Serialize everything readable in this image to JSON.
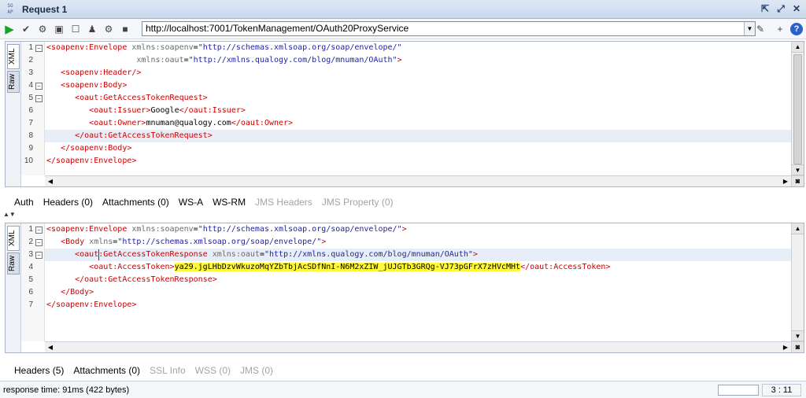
{
  "window": {
    "title": "Request 1",
    "soap_top": "SO",
    "soap_bottom": "AP"
  },
  "toolbar": {
    "url": "http://localhost:7001/TokenManagement/OAuth20ProxyService",
    "help": "?"
  },
  "request": {
    "tabs": {
      "xml": "XML",
      "raw": "Raw"
    },
    "lines": [
      {
        "n": "1",
        "fold": "−",
        "indent": "",
        "parts": [
          [
            "tag",
            "<soapenv:Envelope"
          ],
          [
            "attr",
            " xmlns:soapenv"
          ],
          [
            "text",
            "="
          ],
          [
            "val",
            "\"http://schemas.xmlsoap.org/soap/envelope/\""
          ]
        ]
      },
      {
        "n": "2",
        "fold": "",
        "indent": "                   ",
        "parts": [
          [
            "attr",
            "xmlns:oaut"
          ],
          [
            "text",
            "="
          ],
          [
            "val",
            "\"http://xmlns.qualogy.com/blog/mnuman/OAuth\""
          ],
          [
            "tag",
            ">"
          ]
        ]
      },
      {
        "n": "3",
        "fold": "",
        "indent": "   ",
        "parts": [
          [
            "tag",
            "<soapenv:Header/>"
          ]
        ]
      },
      {
        "n": "4",
        "fold": "−",
        "indent": "   ",
        "parts": [
          [
            "tag",
            "<soapenv:Body>"
          ]
        ]
      },
      {
        "n": "5",
        "fold": "−",
        "indent": "      ",
        "parts": [
          [
            "tag",
            "<oaut:GetAccessTokenRequest>"
          ]
        ]
      },
      {
        "n": "6",
        "fold": "",
        "indent": "         ",
        "parts": [
          [
            "tag",
            "<oaut:Issuer>"
          ],
          [
            "text",
            "Google"
          ],
          [
            "tag",
            "</oaut:Issuer>"
          ]
        ]
      },
      {
        "n": "7",
        "fold": "",
        "indent": "         ",
        "parts": [
          [
            "tag",
            "<oaut:Owner>"
          ],
          [
            "text",
            "mnuman@qualogy.com"
          ],
          [
            "tag",
            "</oaut:Owner>"
          ]
        ]
      },
      {
        "n": "8",
        "fold": "",
        "indent": "      ",
        "parts": [
          [
            "tag",
            "</oaut:GetAccessTokenRequest>"
          ]
        ],
        "current": true
      },
      {
        "n": "9",
        "fold": "",
        "indent": "   ",
        "parts": [
          [
            "tag",
            "</soapenv:Body>"
          ]
        ]
      },
      {
        "n": "10",
        "fold": "",
        "indent": "",
        "parts": [
          [
            "tag",
            "</soapenv:Envelope>"
          ]
        ]
      }
    ],
    "bottom_tabs": [
      {
        "label": "Auth",
        "enabled": true
      },
      {
        "label": "Headers (0)",
        "enabled": true
      },
      {
        "label": "Attachments (0)",
        "enabled": true
      },
      {
        "label": "WS-A",
        "enabled": true
      },
      {
        "label": "WS-RM",
        "enabled": true
      },
      {
        "label": "JMS Headers",
        "enabled": false
      },
      {
        "label": "JMS Property (0)",
        "enabled": false
      }
    ]
  },
  "response": {
    "tabs": {
      "xml": "XML",
      "raw": "Raw"
    },
    "lines": [
      {
        "n": "1",
        "fold": "−",
        "indent": "",
        "parts": [
          [
            "tag",
            "<soapenv:Envelope"
          ],
          [
            "attr",
            " xmlns:soapenv"
          ],
          [
            "text",
            "="
          ],
          [
            "val",
            "\"http://schemas.xmlsoap.org/soap/envelope/\""
          ],
          [
            "tag",
            ">"
          ]
        ]
      },
      {
        "n": "2",
        "fold": "−",
        "indent": "   ",
        "parts": [
          [
            "tag",
            "<Body"
          ],
          [
            "attr",
            " xmlns"
          ],
          [
            "text",
            "="
          ],
          [
            "val",
            "\"http://schemas.xmlsoap.org/soap/envelope/\""
          ],
          [
            "tag",
            ">"
          ]
        ]
      },
      {
        "n": "3",
        "fold": "−",
        "indent": "      ",
        "parts": [
          [
            "tag",
            "<oaut:GetAccessTokenResponse"
          ],
          [
            "attr",
            " xmlns:oaut"
          ],
          [
            "text",
            "="
          ],
          [
            "val",
            "\"http://xmlns.qualogy.com/blog/mnuman/OAuth\""
          ],
          [
            "tag",
            ">"
          ]
        ],
        "current": true
      },
      {
        "n": "4",
        "fold": "",
        "indent": "         ",
        "parts": [
          [
            "tag",
            "<oaut:AccessToken>"
          ],
          [
            "hl",
            "ya29.jgLHbDzvWkuzoMqYZbTbjAcSDfNnI-N6M2xZIW_jUJGTb3GRQg-VJ73pGFrX7zHVcMHt"
          ],
          [
            "tag",
            "</oaut:AccessToken>"
          ]
        ]
      },
      {
        "n": "5",
        "fold": "",
        "indent": "      ",
        "parts": [
          [
            "tag",
            "</oaut:GetAccessTokenResponse>"
          ]
        ]
      },
      {
        "n": "6",
        "fold": "",
        "indent": "   ",
        "parts": [
          [
            "tag",
            "</Body>"
          ]
        ]
      },
      {
        "n": "7",
        "fold": "",
        "indent": "",
        "parts": [
          [
            "tag",
            "</soapenv:Envelope>"
          ]
        ]
      }
    ],
    "bottom_tabs": [
      {
        "label": "Headers (5)",
        "enabled": true
      },
      {
        "label": "Attachments (0)",
        "enabled": true
      },
      {
        "label": "SSL Info",
        "enabled": false
      },
      {
        "label": "WSS (0)",
        "enabled": false
      },
      {
        "label": "JMS (0)",
        "enabled": false
      }
    ]
  },
  "status": {
    "text": "response time: 91ms (422 bytes)",
    "position": "3 : 11"
  }
}
